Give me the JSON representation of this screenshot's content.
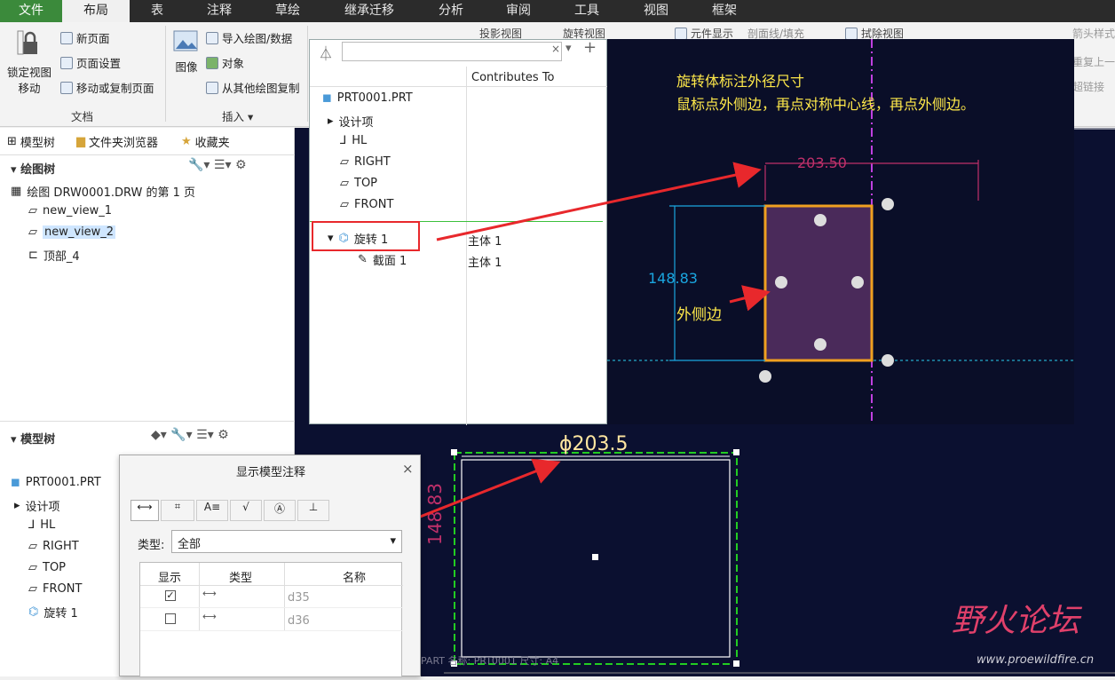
{
  "tabs": [
    "文件",
    "布局",
    "表",
    "注释",
    "草绘",
    "继承迁移",
    "分析",
    "审阅",
    "工具",
    "视图",
    "框架"
  ],
  "ribbon": {
    "lock_view": "锁定视图\n移动",
    "new_page": "新页面",
    "page_setup": "页面设置",
    "move_copy_page": "移动或复制页面",
    "group_doc": "文档",
    "image": "图像",
    "import_drawing": "导入绘图/数据",
    "object": "对象",
    "copy_from_other": "从其他绘图复制",
    "group_insert": "插入",
    "proj_view": "投影视图",
    "rot_view": "旋转视图",
    "elem_display": "元件显示",
    "section_fill": "剖面线/填充",
    "erase_view": "拭除视图",
    "arrow_style": "箭头样式",
    "repeat_last": "重复上一",
    "hyperlink": "超链接"
  },
  "left_tabs": [
    "模型树",
    "文件夹浏览器",
    "收藏夹"
  ],
  "drawing_tree": {
    "title": "绘图树",
    "root": "绘图 DRW0001.DRW 的第 1 页",
    "items": [
      "new_view_1",
      "new_view_2",
      "顶部_4"
    ]
  },
  "model_tree": {
    "title": "模型树",
    "items": [
      "PRT0001.PRT",
      "设计项",
      "HL",
      "RIGHT",
      "TOP",
      "FRONT",
      "旋转 1"
    ]
  },
  "popup": {
    "col_header": "Contributes To",
    "items": [
      "PRT0001.PRT",
      "设计项",
      "HL",
      "RIGHT",
      "TOP",
      "FRONT",
      "旋转 1",
      "截面 1"
    ],
    "contrib": [
      "主体 1",
      "主体 1"
    ]
  },
  "dark": {
    "note_line1": "旋转体标注外径尺寸",
    "note_line2": "鼠标点外侧边，再点对称中心线，再点外侧边。",
    "dim_h": "203.50",
    "dim_v": "148.83",
    "outer_edge": "外侧边"
  },
  "canvas": {
    "dim_dia": "ϕ203.5",
    "dim_v": "148.83",
    "footer": "PART  名称: PRT0001   尺寸: A4"
  },
  "dialog": {
    "title": "显示模型注释",
    "type_label": "类型:",
    "type_value": "全部",
    "col_show": "显示",
    "col_type": "类型",
    "col_name": "名称",
    "rows": [
      {
        "name": "d35",
        "checked": true
      },
      {
        "name": "d36",
        "checked": false
      }
    ]
  },
  "watermark": {
    "cn": "野火论坛",
    "url": "www.proewildfire.cn"
  },
  "colors": {
    "file_tab": "#3b8a3b",
    "canvas_bg": "#0b1030",
    "dim_pink": "#c0306a",
    "dim_cyan": "#1aa6e0",
    "note_yellow": "#ffe94a",
    "edge_orange": "#f0a020",
    "red_arrow": "#e8282c",
    "green_frame": "#22cc22"
  }
}
